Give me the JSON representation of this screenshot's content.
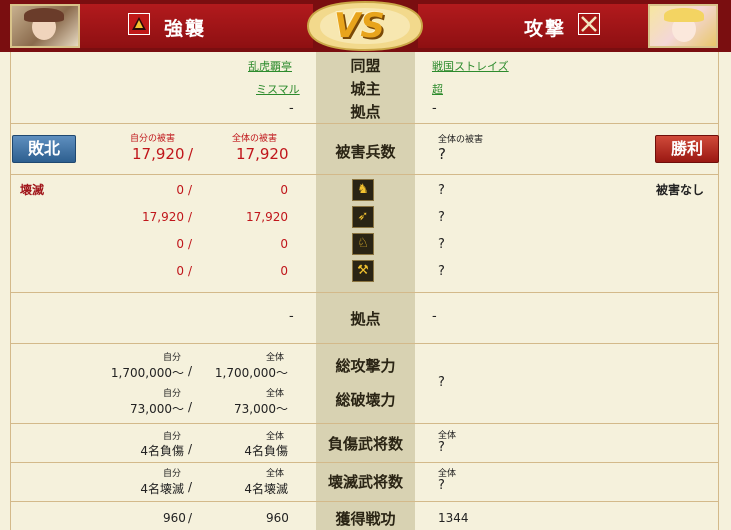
{
  "header": {
    "attacker_label": "強襲",
    "defender_label": "攻撃",
    "vs_text": "VS"
  },
  "alliance": {
    "label": "同盟",
    "left": "乱虎覇亭",
    "right": "戦国ストレイズ"
  },
  "lord": {
    "label": "城主",
    "left": "ミスマル",
    "right": "超"
  },
  "base": {
    "label": "拠点",
    "left": "-",
    "right": "-"
  },
  "casualties": {
    "label": "被害兵数",
    "left_self_caption": "自分の被害",
    "left_total_caption": "全体の被害",
    "left_self": "17,920",
    "left_slash": "/",
    "left_total": "17,920",
    "right_caption": "全体の被害",
    "right_value": "?"
  },
  "result": {
    "left": "敗北",
    "right": "勝利"
  },
  "units": {
    "left_status": "壊滅",
    "right_status": "被害なし",
    "rows": [
      {
        "icon": "infantry-icon",
        "glyph": "♞",
        "self": "0",
        "total": "0",
        "right": "?"
      },
      {
        "icon": "archer-icon",
        "glyph": "➶",
        "self": "17,920",
        "total": "17,920",
        "right": "?"
      },
      {
        "icon": "cavalry-icon",
        "glyph": "♘",
        "self": "0",
        "total": "0",
        "right": "?"
      },
      {
        "icon": "siege-icon",
        "glyph": "⚒",
        "self": "0",
        "total": "0",
        "right": "?"
      }
    ]
  },
  "base2": {
    "label": "拠点",
    "left": "-",
    "right": "-"
  },
  "attack": {
    "label": "総攻撃力",
    "self_caption": "自分",
    "total_caption": "全体",
    "self": "1,700,000〜",
    "total": "1,700,000〜"
  },
  "destroy": {
    "label": "総破壊力",
    "self_caption": "自分",
    "total_caption": "全体",
    "self": "73,000〜",
    "total": "73,000〜"
  },
  "attack_destroy_right": "?",
  "wounded": {
    "label": "負傷武将数",
    "self_caption": "自分",
    "total_caption": "全体",
    "self": "4名負傷",
    "total": "4名負傷",
    "right_caption": "全体",
    "right": "?"
  },
  "destroyed": {
    "label": "壊滅武将数",
    "self_caption": "自分",
    "total_caption": "全体",
    "self": "4名壊滅",
    "total": "4名壊滅",
    "right_caption": "全体",
    "right": "?"
  },
  "merit": {
    "label": "獲得戦功",
    "self": "960",
    "total": "960",
    "right": "1344"
  },
  "slash": "/",
  "colors": {
    "header_red": "#8e1012",
    "background": "#f5f1dc",
    "middle": "#d8d2b2",
    "link": "#2d8b2d"
  }
}
